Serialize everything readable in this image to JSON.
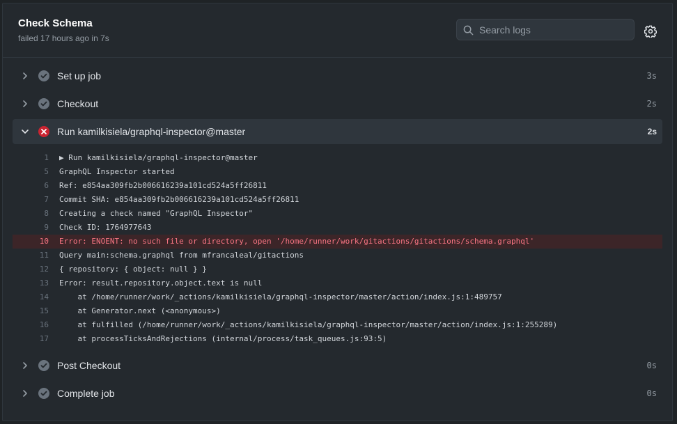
{
  "header": {
    "title": "Check Schema",
    "subtitle": "failed 17 hours ago in 7s",
    "search_placeholder": "Search logs"
  },
  "steps_before": [
    {
      "label": "Set up job",
      "duration": "3s",
      "status": "success"
    },
    {
      "label": "Checkout",
      "duration": "2s",
      "status": "success"
    }
  ],
  "expanded_step": {
    "label": "Run kamilkisiela/graphql-inspector@master",
    "duration": "2s",
    "status": "failure",
    "log": [
      {
        "num": "1",
        "text": "▶ Run kamilkisiela/graphql-inspector@master",
        "error": false
      },
      {
        "num": "5",
        "text": "GraphQL Inspector started",
        "error": false
      },
      {
        "num": "6",
        "text": "Ref: e854aa309fb2b006616239a101cd524a5ff26811",
        "error": false
      },
      {
        "num": "7",
        "text": "Commit SHA: e854aa309fb2b006616239a101cd524a5ff26811",
        "error": false
      },
      {
        "num": "8",
        "text": "Creating a check named \"GraphQL Inspector\"",
        "error": false
      },
      {
        "num": "9",
        "text": "Check ID: 1764977643",
        "error": false
      },
      {
        "num": "10",
        "text": "Error: ENOENT: no such file or directory, open '/home/runner/work/gitactions/gitactions/schema.graphql'",
        "error": true
      },
      {
        "num": "11",
        "text": "Query main:schema.graphql from mfrancaleal/gitactions",
        "error": false
      },
      {
        "num": "12",
        "text": "{ repository: { object: null } }",
        "error": false
      },
      {
        "num": "13",
        "text": "Error: result.repository.object.text is null",
        "error": false
      },
      {
        "num": "14",
        "text": "    at /home/runner/work/_actions/kamilkisiela/graphql-inspector/master/action/index.js:1:489757",
        "error": false
      },
      {
        "num": "15",
        "text": "    at Generator.next (<anonymous>)",
        "error": false
      },
      {
        "num": "16",
        "text": "    at fulfilled (/home/runner/work/_actions/kamilkisiela/graphql-inspector/master/action/index.js:1:255289)",
        "error": false
      },
      {
        "num": "17",
        "text": "    at processTicksAndRejections (internal/process/task_queues.js:93:5)",
        "error": false
      }
    ]
  },
  "steps_after": [
    {
      "label": "Post Checkout",
      "duration": "0s",
      "status": "success"
    },
    {
      "label": "Complete job",
      "duration": "0s",
      "status": "success"
    }
  ],
  "colors": {
    "success": "#6a737d",
    "failure": "#cb2431",
    "error_line_bg": "#3c2528",
    "error_text": "#f97583"
  },
  "icons": {
    "search": "search-icon",
    "settings": "gear-icon",
    "collapsed": "chevron-right-icon",
    "expanded": "chevron-down-icon",
    "success": "check-circle-icon",
    "failure": "x-circle-icon"
  }
}
